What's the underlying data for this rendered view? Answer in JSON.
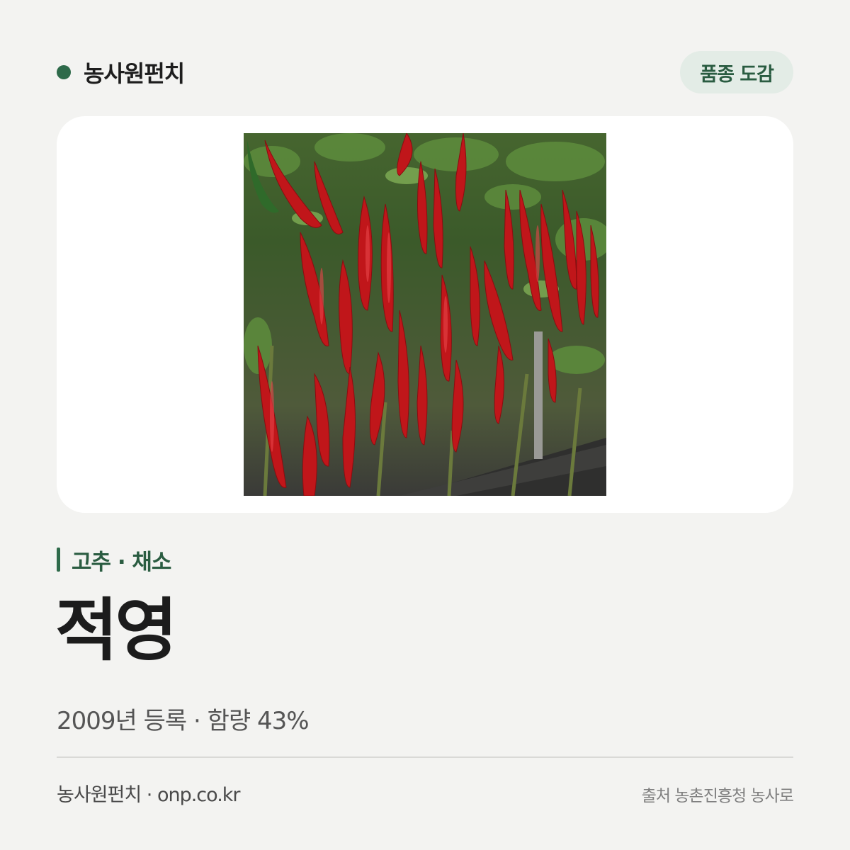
{
  "header": {
    "brand": "농사원펀치",
    "badge": "품종 도감"
  },
  "photo": {
    "alt": "적영 고추"
  },
  "category": "고추 · 채소",
  "title": "적영",
  "meta": "2009년 등록 · 함량 43%",
  "footer": {
    "site": "농사원펀치 · onp.co.kr",
    "source": "출처 농촌진흥청 농사로"
  },
  "colors": {
    "accent": "#2e6a4a",
    "badge_bg": "#e3ece6",
    "background": "#f3f3f1"
  }
}
